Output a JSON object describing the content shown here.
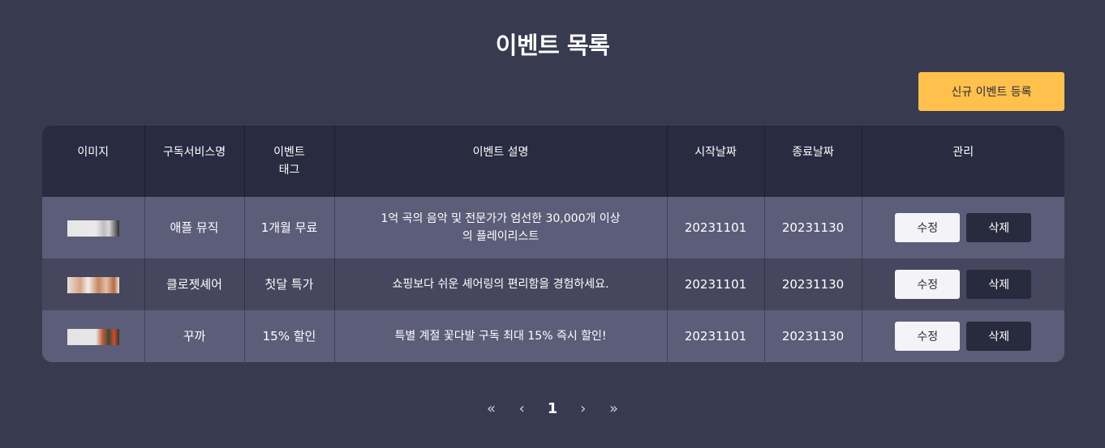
{
  "page": {
    "title": "이벤트 목록",
    "add_button_label": "신규 이벤트 등록"
  },
  "table": {
    "headers": [
      "이미지",
      "구독서비스명",
      "이벤트\n태그",
      "이벤트 설명",
      "시작날짜",
      "종료날짜",
      "관리"
    ],
    "rows": [
      {
        "service": "애플 뮤직",
        "tag": "1개월 무료",
        "description": "1억 곡의 음악 및 전문가가 엄선한 30,000개 이상의 플레이리스트",
        "start_date": "20231101",
        "end_date": "20231130",
        "edit_label": "수정",
        "delete_label": "삭제"
      },
      {
        "service": "클로젯셰어",
        "tag": "첫달 특가",
        "description": "쇼핑보다 쉬운 셰어링의 편리함을 경험하세요.",
        "start_date": "20231101",
        "end_date": "20231130",
        "edit_label": "수정",
        "delete_label": "삭제"
      },
      {
        "service": "꾸까",
        "tag": "15% 할인",
        "description": "특별 계절 꽃다발 구독 최대 15% 즉시 할인!",
        "start_date": "20231101",
        "end_date": "20231130",
        "edit_label": "수정",
        "delete_label": "삭제"
      }
    ]
  },
  "pagination": {
    "first": "«",
    "prev": "‹",
    "current": "1",
    "next": "›",
    "last": "»"
  },
  "colors": {
    "background": "#383a4f",
    "header_bg": "#292b40",
    "row_odd": "#5c5d79",
    "row_even": "#46475f",
    "accent": "#ffc04c"
  }
}
